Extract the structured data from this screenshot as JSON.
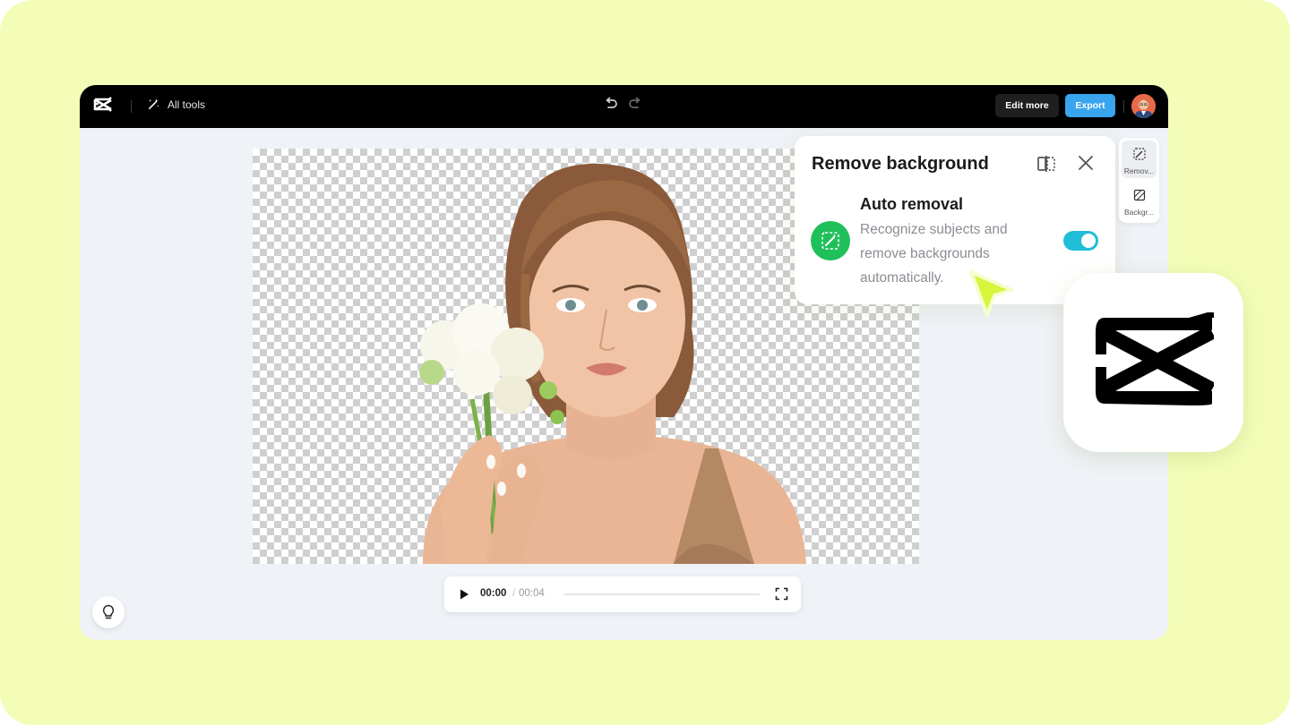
{
  "topbar": {
    "all_tools_label": "All tools",
    "edit_more_label": "Edit more",
    "export_label": "Export"
  },
  "player": {
    "current_time": "00:00",
    "separator": "/",
    "duration": "00:04"
  },
  "panel": {
    "title": "Remove background",
    "feature_title": "Auto removal",
    "feature_description": "Recognize subjects and remove backgrounds automatically.",
    "toggle_on": true
  },
  "side_tabs": [
    {
      "label": "Remov..."
    },
    {
      "label": "Backgr..."
    }
  ],
  "colors": {
    "page_background": "#f3fdb8",
    "topbar": "#000000",
    "export_button": "#38a5ee",
    "toggle": "#21bdd8",
    "feature_icon": "#1fc05a",
    "cursor": "#d8f53b"
  }
}
